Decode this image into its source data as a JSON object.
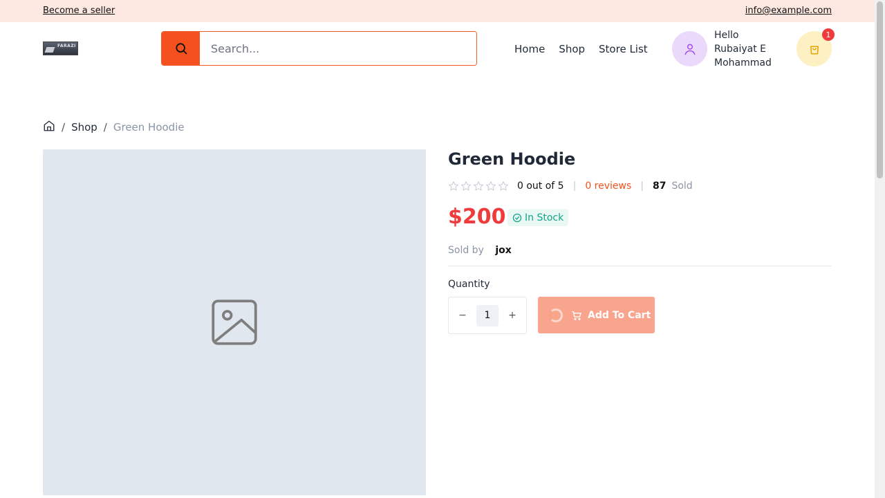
{
  "topbar": {
    "seller_link": "Become a seller",
    "email": "info@example.com"
  },
  "header": {
    "logo_text": "FARAZI",
    "search_placeholder": "Search...",
    "nav": [
      "Home",
      "Shop",
      "Store List"
    ],
    "user_greeting": "Hello",
    "user_name": "Rubaiyat E Mohammad",
    "cart_count": "1"
  },
  "breadcrumb": {
    "shop": "Shop",
    "current": "Green Hoodie"
  },
  "product": {
    "title": "Green Hoodie",
    "rating_stars": 0,
    "rating_text": "0 out of 5",
    "reviews": "0 reviews",
    "sold_count": "87",
    "sold_label": "Sold",
    "price": "$200",
    "stock_status": "In Stock",
    "sold_by_label": "Sold by",
    "seller": "jox",
    "quantity_label": "Quantity",
    "quantity": "1",
    "add_to_cart_label": "Add To Cart"
  },
  "colors": {
    "accent": "#f4511e",
    "price": "#ef3b3b",
    "stock": "#12a58a",
    "topbar_bg": "#fde8e2"
  }
}
